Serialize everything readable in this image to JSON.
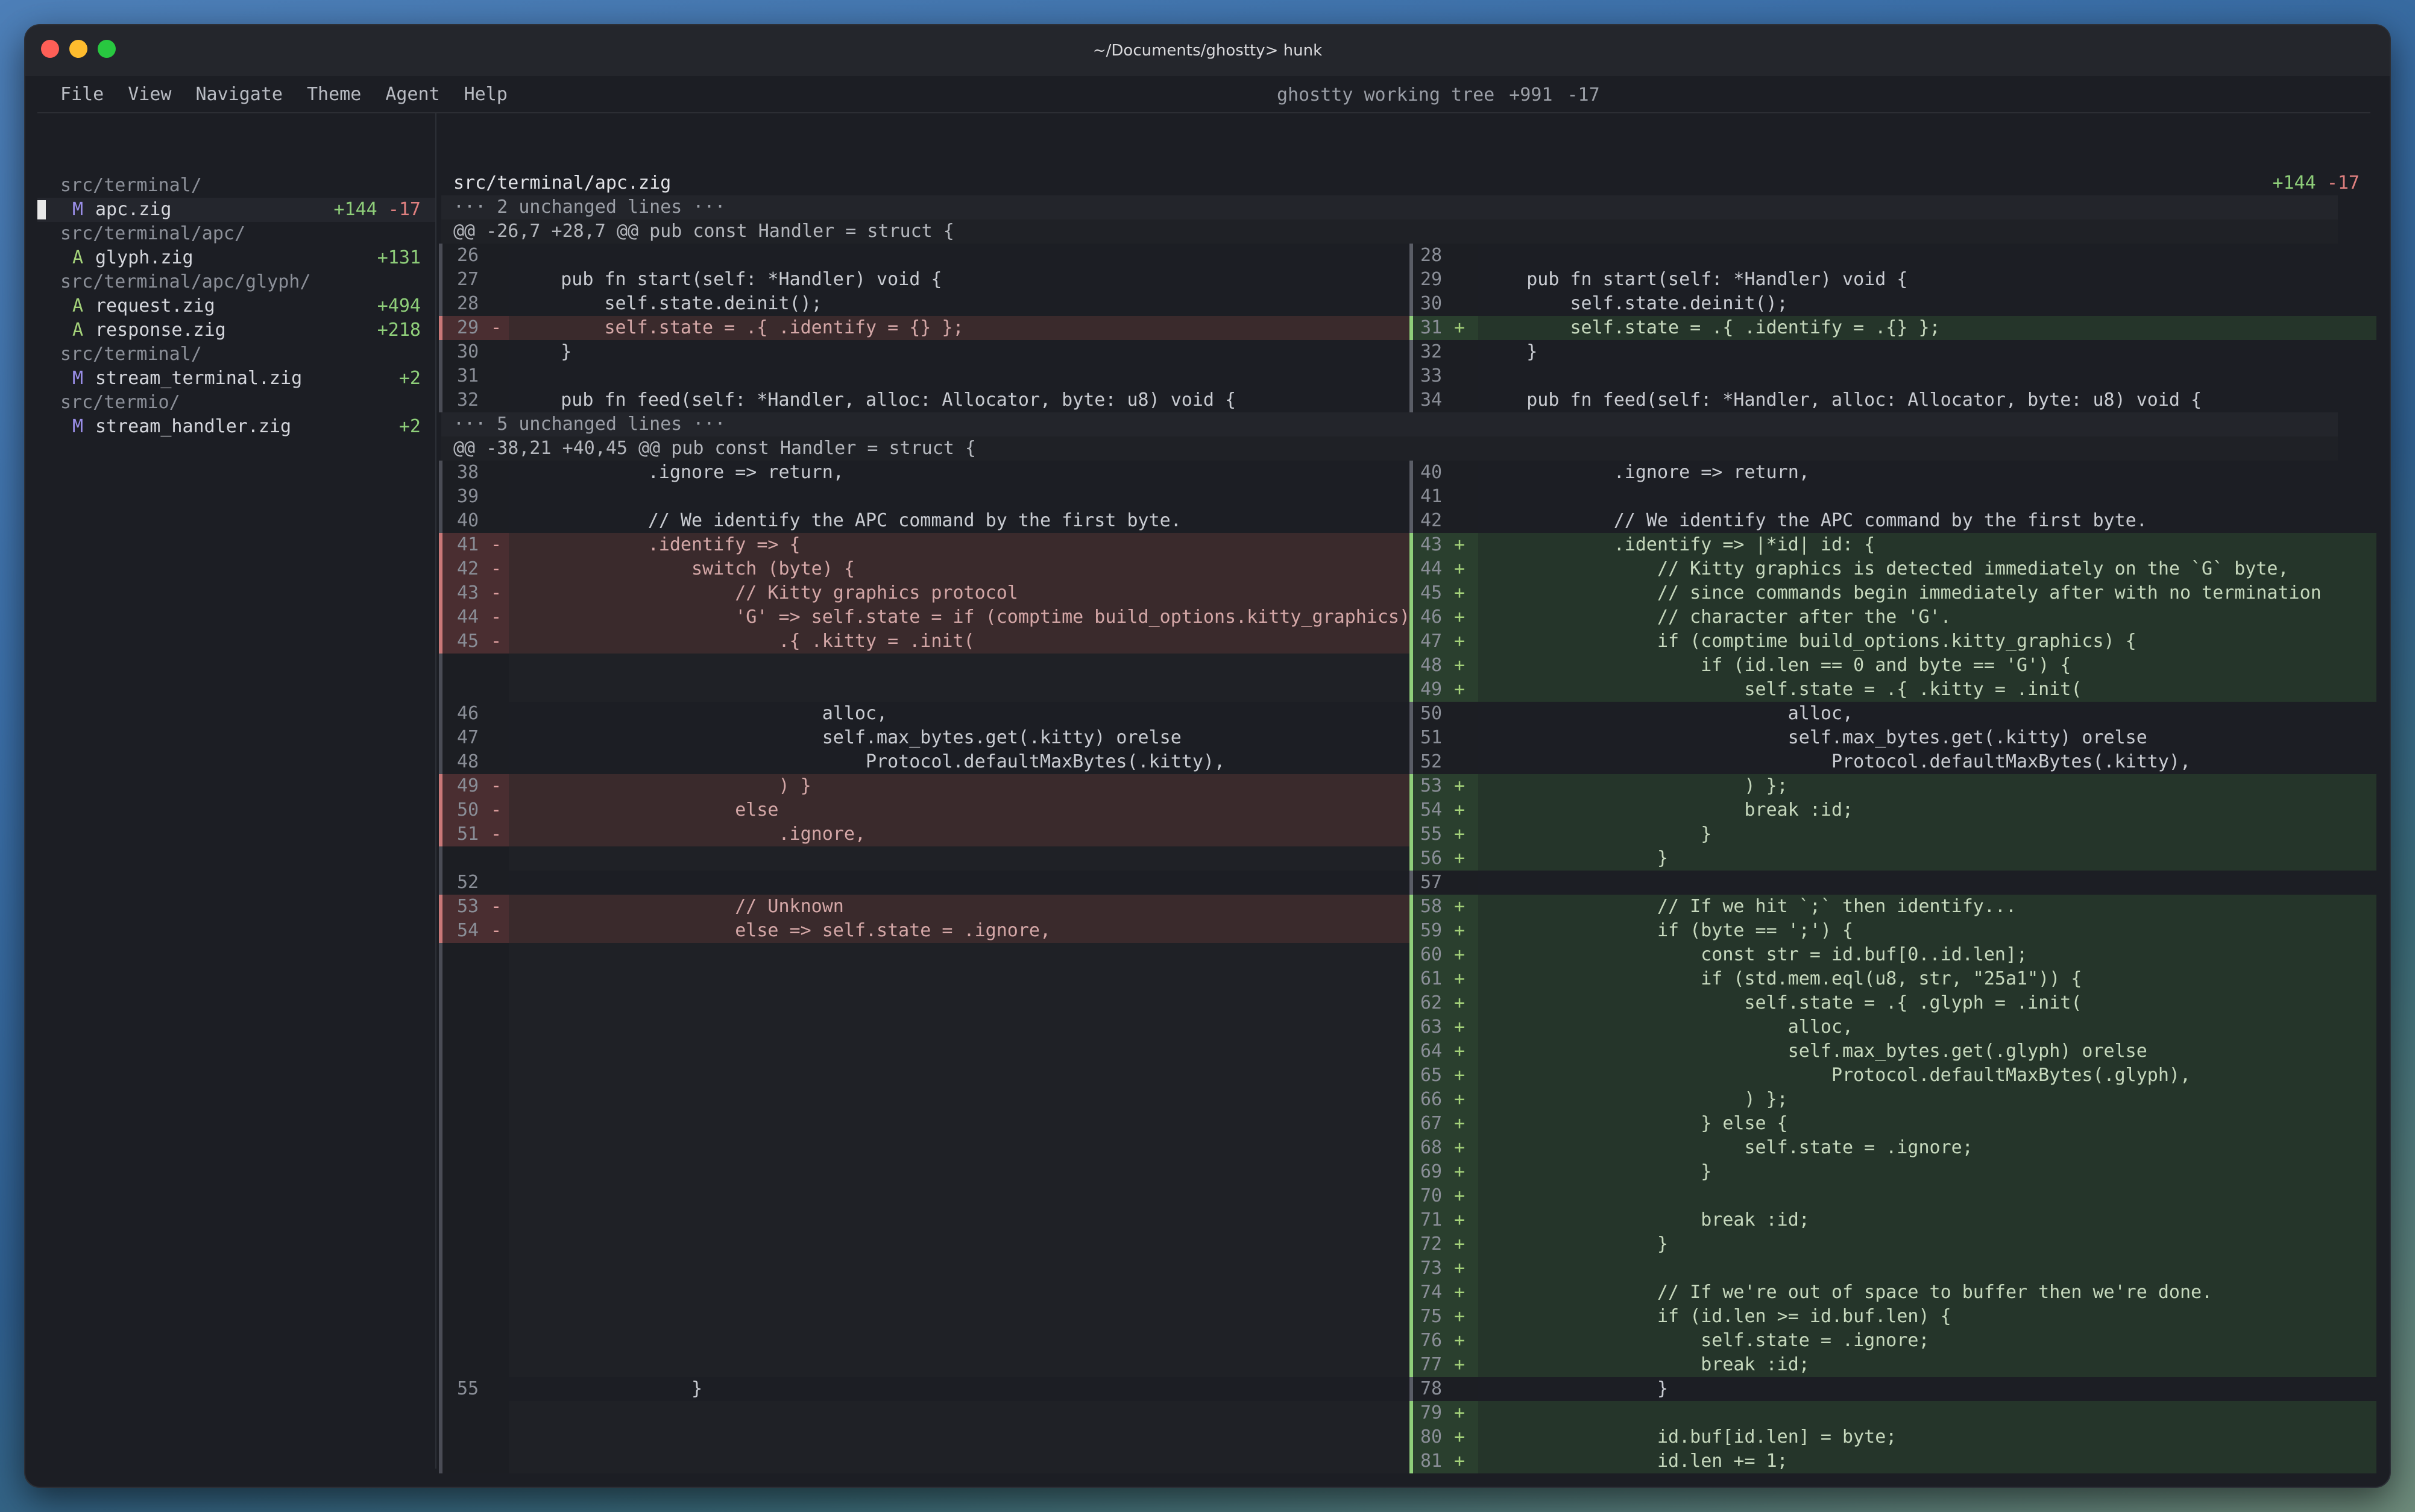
{
  "window": {
    "title": "~/Documents/ghostty> hunk",
    "traffic_colors": {
      "close": "#fe5f57",
      "minimize": "#febc2e",
      "maximize": "#28c840"
    }
  },
  "menu": {
    "items": [
      "File",
      "View",
      "Navigate",
      "Theme",
      "Agent",
      "Help"
    ],
    "repo_label": "ghostty working tree",
    "additions": "+991",
    "deletions": "-17"
  },
  "sidebar": {
    "groups": [
      {
        "dir": "src/terminal/",
        "files": [
          {
            "status": "M",
            "name": "apc.zig",
            "add": "+144",
            "del": "-17",
            "active": true
          }
        ]
      },
      {
        "dir": "src/terminal/apc/",
        "files": [
          {
            "status": "A",
            "name": "glyph.zig",
            "add": "+131",
            "del": ""
          }
        ]
      },
      {
        "dir": "src/terminal/apc/glyph/",
        "files": [
          {
            "status": "A",
            "name": "request.zig",
            "add": "+494",
            "del": ""
          },
          {
            "status": "A",
            "name": "response.zig",
            "add": "+218",
            "del": ""
          }
        ]
      },
      {
        "dir": "src/terminal/",
        "files": [
          {
            "status": "M",
            "name": "stream_terminal.zig",
            "add": "+2",
            "del": ""
          }
        ]
      },
      {
        "dir": "src/termio/",
        "files": [
          {
            "status": "M",
            "name": "stream_handler.zig",
            "add": "+2",
            "del": ""
          }
        ]
      }
    ]
  },
  "diff": {
    "file": "src/terminal/apc.zig",
    "add": "+144",
    "del": "-17",
    "colors": {
      "add": "#8fcf7a",
      "del": "#e08080",
      "add_bg": "#25352a",
      "del_bg": "#3a2a2c"
    },
    "rows": [
      {
        "kind": "band",
        "text": "··· 2 unchanged lines ···"
      },
      {
        "kind": "hunk",
        "text": "@@ -26,7 +28,7 @@ pub const Handler = struct {"
      },
      {
        "l": [
          "26",
          "",
          ""
        ],
        "r": [
          "28",
          "",
          ""
        ]
      },
      {
        "l": [
          "27",
          "",
          "    pub fn start(self: *Handler) void {"
        ],
        "r": [
          "29",
          "",
          "    pub fn start(self: *Handler) void {"
        ]
      },
      {
        "l": [
          "28",
          "",
          "        self.state.deinit();"
        ],
        "r": [
          "30",
          "",
          "        self.state.deinit();"
        ]
      },
      {
        "l": [
          "29",
          "-",
          "        self.state = .{ .identify = {} };"
        ],
        "r": [
          "31",
          "+",
          "        self.state = .{ .identify = .{} };"
        ]
      },
      {
        "l": [
          "30",
          "",
          "    }"
        ],
        "r": [
          "32",
          "",
          "    }"
        ]
      },
      {
        "l": [
          "31",
          "",
          ""
        ],
        "r": [
          "33",
          "",
          ""
        ]
      },
      {
        "l": [
          "32",
          "",
          "    pub fn feed(self: *Handler, alloc: Allocator, byte: u8) void {"
        ],
        "r": [
          "34",
          "",
          "    pub fn feed(self: *Handler, alloc: Allocator, byte: u8) void {"
        ]
      },
      {
        "kind": "band",
        "text": "··· 5 unchanged lines ···"
      },
      {
        "kind": "hunk",
        "text": "@@ -38,21 +40,45 @@ pub const Handler = struct {"
      },
      {
        "l": [
          "38",
          "",
          "            .ignore => return,"
        ],
        "r": [
          "40",
          "",
          "            .ignore => return,"
        ]
      },
      {
        "l": [
          "39",
          "",
          ""
        ],
        "r": [
          "41",
          "",
          ""
        ]
      },
      {
        "l": [
          "40",
          "",
          "            // We identify the APC command by the first byte."
        ],
        "r": [
          "42",
          "",
          "            // We identify the APC command by the first byte."
        ]
      },
      {
        "l": [
          "41",
          "-",
          "            .identify => {"
        ],
        "r": [
          "43",
          "+",
          "            .identify => |*id| id: {"
        ]
      },
      {
        "l": [
          "42",
          "-",
          "                switch (byte) {"
        ],
        "r": [
          "44",
          "+",
          "                // Kitty graphics is detected immediately on the `G` byte,"
        ]
      },
      {
        "l": [
          "43",
          "-",
          "                    // Kitty graphics protocol"
        ],
        "r": [
          "45",
          "+",
          "                // since commands begin immediately after with no termination"
        ]
      },
      {
        "l": [
          "44",
          "-",
          "                    'G' => self.state = if (comptime build_options.kitty_graphics)"
        ],
        "r": [
          "46",
          "+",
          "                // character after the 'G'."
        ]
      },
      {
        "l": [
          "45",
          "-",
          "                        .{ .kitty = .init("
        ],
        "r": [
          "47",
          "+",
          "                if (comptime build_options.kitty_graphics) {"
        ]
      },
      {
        "l": [
          "",
          "x",
          ""
        ],
        "r": [
          "48",
          "+",
          "                    if (id.len == 0 and byte == 'G') {"
        ]
      },
      {
        "l": [
          "",
          "x",
          ""
        ],
        "r": [
          "49",
          "+",
          "                        self.state = .{ .kitty = .init("
        ]
      },
      {
        "l": [
          "46",
          "",
          "                            alloc,"
        ],
        "r": [
          "50",
          "",
          "                            alloc,"
        ]
      },
      {
        "l": [
          "47",
          "",
          "                            self.max_bytes.get(.kitty) orelse"
        ],
        "r": [
          "51",
          "",
          "                            self.max_bytes.get(.kitty) orelse"
        ]
      },
      {
        "l": [
          "48",
          "",
          "                                Protocol.defaultMaxBytes(.kitty),"
        ],
        "r": [
          "52",
          "",
          "                                Protocol.defaultMaxBytes(.kitty),"
        ]
      },
      {
        "l": [
          "49",
          "-",
          "                        ) }"
        ],
        "r": [
          "53",
          "+",
          "                        ) };"
        ]
      },
      {
        "l": [
          "50",
          "-",
          "                    else"
        ],
        "r": [
          "54",
          "+",
          "                        break :id;"
        ]
      },
      {
        "l": [
          "51",
          "-",
          "                        .ignore,"
        ],
        "r": [
          "55",
          "+",
          "                    }"
        ]
      },
      {
        "l": [
          "",
          "x",
          ""
        ],
        "r": [
          "56",
          "+",
          "                }"
        ]
      },
      {
        "l": [
          "52",
          "",
          ""
        ],
        "r": [
          "57",
          "",
          ""
        ]
      },
      {
        "l": [
          "53",
          "-",
          "                    // Unknown"
        ],
        "r": [
          "58",
          "+",
          "                // If we hit `;` then identify..."
        ]
      },
      {
        "l": [
          "54",
          "-",
          "                    else => self.state = .ignore,"
        ],
        "r": [
          "59",
          "+",
          "                if (byte == ';') {"
        ]
      },
      {
        "l": [
          "",
          "x",
          ""
        ],
        "r": [
          "60",
          "+",
          "                    const str = id.buf[0..id.len];"
        ]
      },
      {
        "l": [
          "",
          "x",
          ""
        ],
        "r": [
          "61",
          "+",
          "                    if (std.mem.eql(u8, str, \"25a1\")) {"
        ]
      },
      {
        "l": [
          "",
          "x",
          ""
        ],
        "r": [
          "62",
          "+",
          "                        self.state = .{ .glyph = .init("
        ]
      },
      {
        "l": [
          "",
          "x",
          ""
        ],
        "r": [
          "63",
          "+",
          "                            alloc,"
        ]
      },
      {
        "l": [
          "",
          "x",
          ""
        ],
        "r": [
          "64",
          "+",
          "                            self.max_bytes.get(.glyph) orelse"
        ]
      },
      {
        "l": [
          "",
          "x",
          ""
        ],
        "r": [
          "65",
          "+",
          "                                Protocol.defaultMaxBytes(.glyph),"
        ]
      },
      {
        "l": [
          "",
          "x",
          ""
        ],
        "r": [
          "66",
          "+",
          "                        ) };"
        ]
      },
      {
        "l": [
          "",
          "x",
          ""
        ],
        "r": [
          "67",
          "+",
          "                    } else {"
        ]
      },
      {
        "l": [
          "",
          "x",
          ""
        ],
        "r": [
          "68",
          "+",
          "                        self.state = .ignore;"
        ]
      },
      {
        "l": [
          "",
          "x",
          ""
        ],
        "r": [
          "69",
          "+",
          "                    }"
        ]
      },
      {
        "l": [
          "",
          "x",
          ""
        ],
        "r": [
          "70",
          "+",
          ""
        ]
      },
      {
        "l": [
          "",
          "x",
          ""
        ],
        "r": [
          "71",
          "+",
          "                    break :id;"
        ]
      },
      {
        "l": [
          "",
          "x",
          ""
        ],
        "r": [
          "72",
          "+",
          "                }"
        ]
      },
      {
        "l": [
          "",
          "x",
          ""
        ],
        "r": [
          "73",
          "+",
          ""
        ]
      },
      {
        "l": [
          "",
          "x",
          ""
        ],
        "r": [
          "74",
          "+",
          "                // If we're out of space to buffer then we're done."
        ]
      },
      {
        "l": [
          "",
          "x",
          ""
        ],
        "r": [
          "75",
          "+",
          "                if (id.len >= id.buf.len) {"
        ]
      },
      {
        "l": [
          "",
          "x",
          ""
        ],
        "r": [
          "76",
          "+",
          "                    self.state = .ignore;"
        ]
      },
      {
        "l": [
          "",
          "x",
          ""
        ],
        "r": [
          "77",
          "+",
          "                    break :id;"
        ]
      },
      {
        "l": [
          "55",
          "",
          "                }"
        ],
        "r": [
          "78",
          "",
          "                }"
        ]
      },
      {
        "l": [
          "",
          "x",
          ""
        ],
        "r": [
          "79",
          "+",
          ""
        ]
      },
      {
        "l": [
          "",
          "x",
          ""
        ],
        "r": [
          "80",
          "+",
          "                id.buf[id.len] = byte;"
        ]
      },
      {
        "l": [
          "",
          "x",
          ""
        ],
        "r": [
          "81",
          "+",
          "                id.len += 1;"
        ]
      }
    ]
  }
}
